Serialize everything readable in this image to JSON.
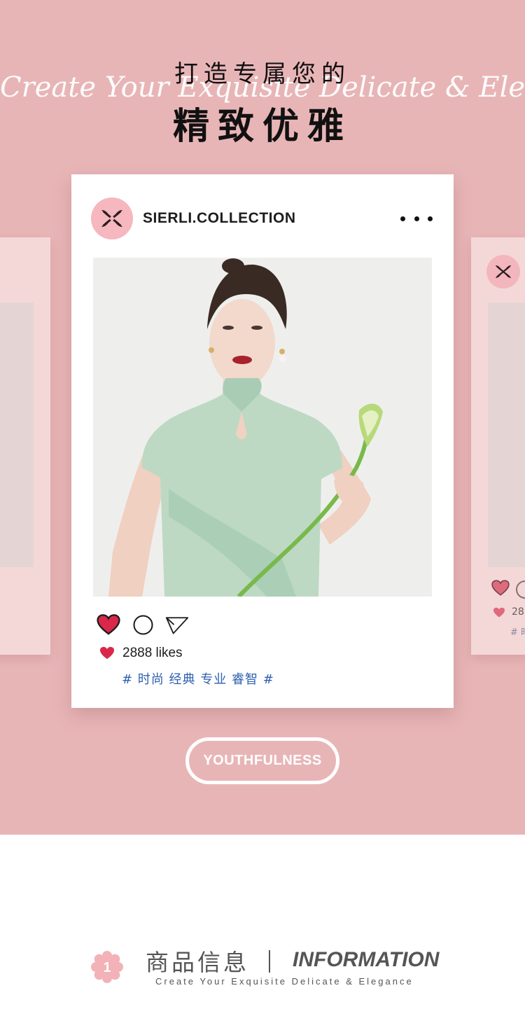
{
  "hero": {
    "title_zh_1": "打造专属您的",
    "title_en_script": "Create Your Exquisite Delicate & Elegance",
    "title_zh_2": "精致优雅",
    "background_color": "#e8b5b7"
  },
  "post": {
    "brand_name": "SIERLI.COLLECTION",
    "avatar_icon": "sierli-monogram-icon",
    "more_icon": "more-dots-icon",
    "likes_text": "2888 likes",
    "tags": "# 时尚 经典 专业 睿智 #",
    "actions": [
      "heart-icon",
      "comment-icon",
      "send-icon"
    ]
  },
  "side_right": {
    "likes_partial": "28",
    "tags_partial": "# 时"
  },
  "cta": {
    "label": "YOUTHFULNESS"
  },
  "info": {
    "badge_number": "1",
    "title_zh": "商品信息",
    "title_en": "INFORMATION",
    "subtitle": "Create Your Exquisite Delicate & Elegance"
  },
  "colors": {
    "accent_pink": "#f6b7be",
    "heart_red": "#d9284a",
    "tag_blue": "#2f60b0",
    "text_dark": "#1d1d1d"
  }
}
